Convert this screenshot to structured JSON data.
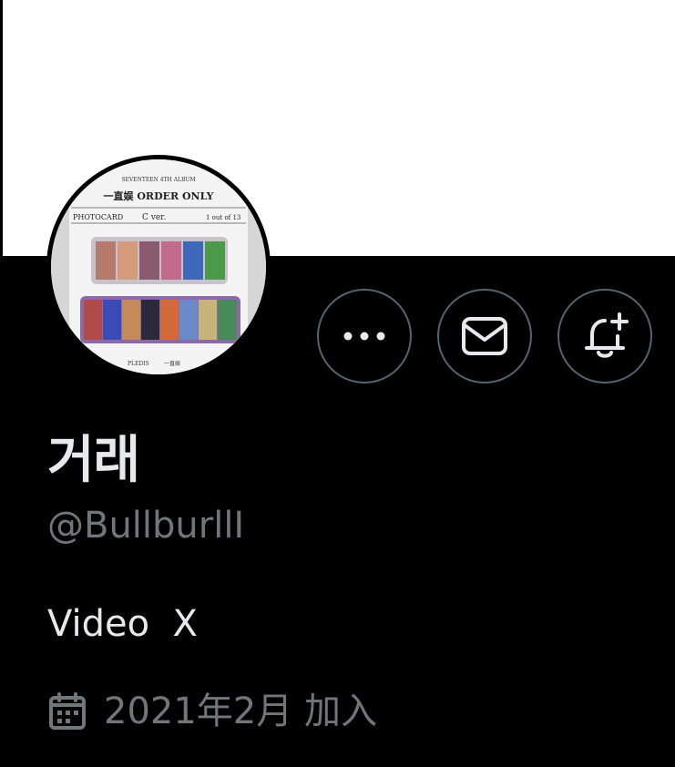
{
  "profile": {
    "display_name": "거래",
    "handle": "@BullburllI",
    "bio": "Video  X",
    "joined": "2021年2月 加入"
  },
  "avatar": {
    "header_text": "SEVENTEEN 4TH ALBUM",
    "title_text": "一直娱 ORDER ONLY",
    "left_label": "PHOTOCARD",
    "mid_label": "C ver.",
    "right_label": "1 out of 13",
    "footer_left": "PLEDIS",
    "footer_right": "一直娱"
  },
  "actions": {
    "more_icon": "more-horizontal-icon",
    "mail_icon": "mail-icon",
    "notify_icon": "bell-plus-icon"
  },
  "colors": {
    "background": "#000000",
    "banner": "#ffffff",
    "border": "#536471",
    "primary_text": "#e7e9ea",
    "secondary_text": "#71767b"
  }
}
